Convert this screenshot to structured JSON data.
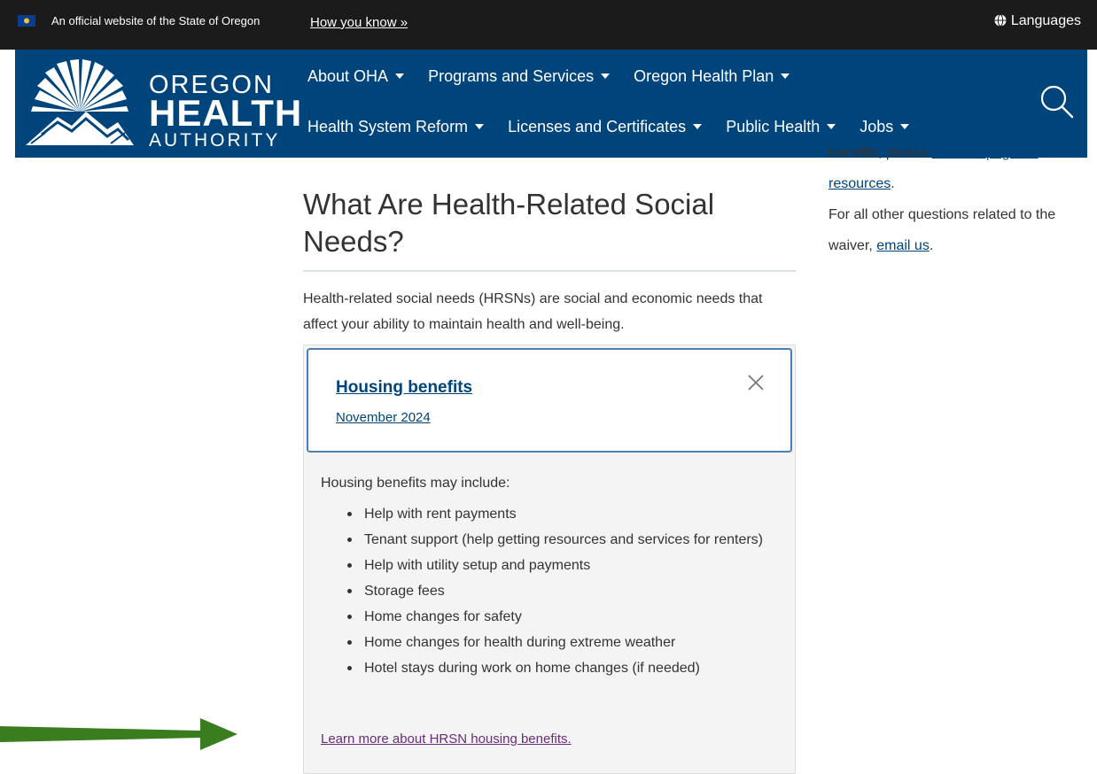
{
  "banner": {
    "official_text": "An official website of the State of Oregon",
    "how_you_know": "How you know »",
    "languages": "Languages"
  },
  "logo": {
    "line1": "OREGON",
    "line2": "HEALTH",
    "line3": "AUTHORITY"
  },
  "nav": {
    "row1": [
      {
        "label": "About OHA"
      },
      {
        "label": "Programs and Services"
      },
      {
        "label": "Oregon Health Plan"
      }
    ],
    "row2": [
      {
        "label": "Health System Reform"
      },
      {
        "label": "Licenses and Certificates"
      },
      {
        "label": "Public Health"
      },
      {
        "label": "Jobs"
      }
    ]
  },
  "main": {
    "title": "What Are Health-Related Social Needs?",
    "intro": "Health-related social needs (HRSNs) are social and economic needs that affect your ability to maintain health and well-being.",
    "accordion": {
      "title": "Housing benefits",
      "date": "November 2024",
      "lead": "Housing benefits may include:",
      "items": [
        "Help with rent payments",
        "Tenant support (help getting resources and services for renters)",
        "Help with utility setup and payments",
        "Storage fees",
        "Home changes for safety",
        "Home changes for health during extreme weather",
        "Hotel stays during work on home changes (if needed)"
      ],
      "link": "Learn more about HRSN housing benefits."
    }
  },
  "sidebar": {
    "line1_text": "benefits, please ",
    "line1_link": "visit this page for",
    "line2_link": "resources",
    "line2_tail": ".",
    "para2_text": "For all other questions related to the waiver, ",
    "para2_link": "email us",
    "para2_tail": "."
  },
  "colors": {
    "header_bg": "#00447c",
    "banner_bg": "#1b1b1b",
    "accent_link": "#00447c",
    "visited_link": "#6b2a7a",
    "arrow": "#3a7d1f"
  }
}
